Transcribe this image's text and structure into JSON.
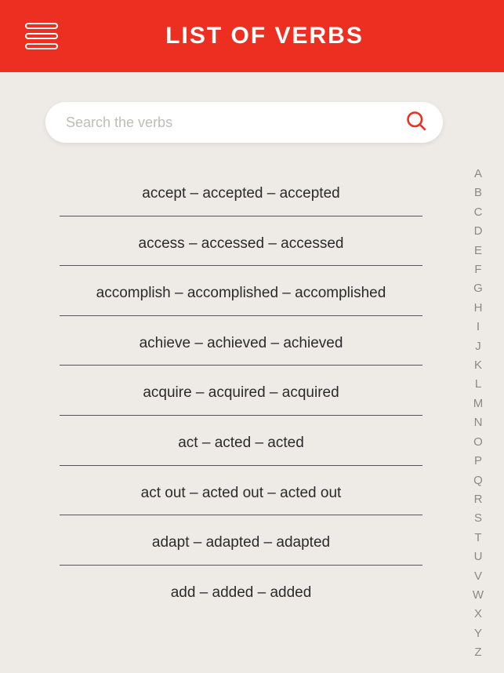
{
  "header": {
    "title": "LIST OF VERBS"
  },
  "search": {
    "placeholder": "Search the verbs"
  },
  "verbs": [
    "accept – accepted – accepted",
    "access – accessed – accessed",
    "accomplish – accomplished – accomplished",
    "achieve – achieved – achieved",
    "acquire – acquired – acquired",
    "act – acted – acted",
    "act out – acted out – acted out",
    "adapt – adapted – adapted",
    "add – added – added"
  ],
  "alpha": [
    "A",
    "B",
    "C",
    "D",
    "E",
    "F",
    "G",
    "H",
    "I",
    "J",
    "K",
    "L",
    "M",
    "N",
    "O",
    "P",
    "Q",
    "R",
    "S",
    "T",
    "U",
    "V",
    "W",
    "X",
    "Y",
    "Z"
  ]
}
